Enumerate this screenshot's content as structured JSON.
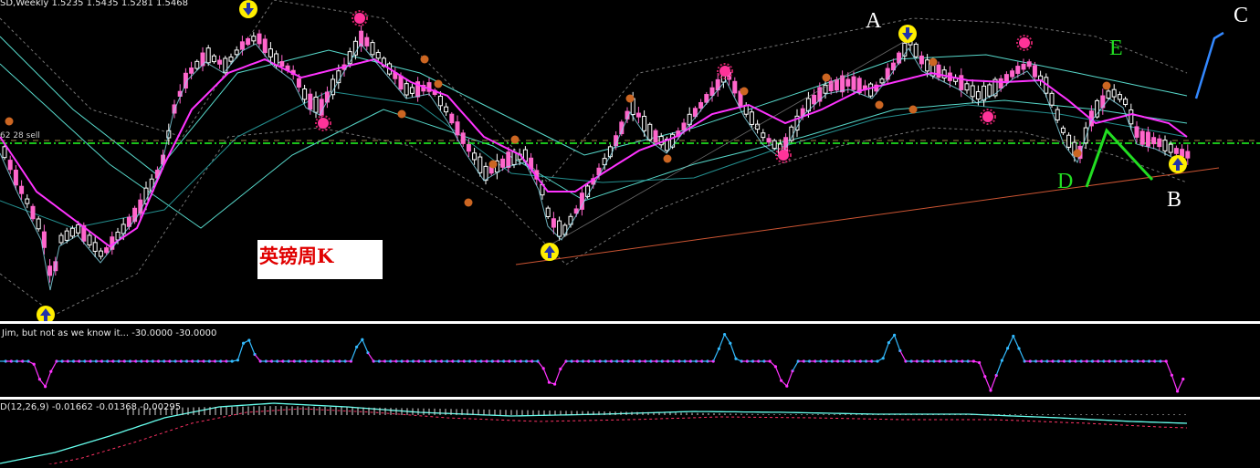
{
  "header": {
    "main_info": "SD,Weekly  1.5235 1.5435 1.5281 1.5468",
    "sell_label": "62 28 sell",
    "indicator_info": "Jim, but not as we know it...  -30.0000 -30.0000",
    "macd_info": "D(12,26,9) -0.01662 -0.01368 -0.00295"
  },
  "title_box": {
    "text": "英镑周K"
  },
  "annotations": {
    "A": "A",
    "B": "B",
    "C": "C",
    "D": "D",
    "E": "E"
  },
  "colors": {
    "background": "#000000",
    "bull_candle": "#ffffff",
    "bear_candle": "#ff66cc",
    "ma_main": "#ff33ff",
    "ma_secondary": "#66ffee",
    "envelope": "#888888",
    "sell_line": "#22ff22",
    "signal_magenta": "#ff33ff",
    "signal_cyan": "#33bbff",
    "trendline": "#cc5533",
    "green_pattern": "#22dd22",
    "blue_arrow": "#3388ff",
    "arrow_marker": "#ffee00",
    "fractal": "#cc6622"
  },
  "chart_data": {
    "type": "line",
    "title": "",
    "timeframe": "Weekly",
    "markers": [
      "down-arrow-icon",
      "up-arrow-icon",
      "fractal-icon",
      "star-icon"
    ]
  }
}
